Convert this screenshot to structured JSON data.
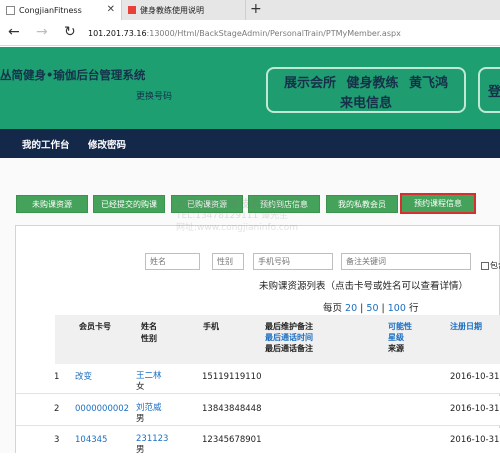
{
  "browser": {
    "active_tab_title": "CongjianFitness",
    "inactive_tab_title": "健身教练使用说明",
    "new_tab_glyph": "+",
    "close_glyph": "✕",
    "url_host": "101.201.73.16",
    "url_path": ":13000/Html/BackStageAdmin/PersonalTrain/PTMyMember.aspx"
  },
  "header": {
    "brand": "丛简健身•瑜伽后台管理系统",
    "change_number": "更换号码",
    "caller_box": {
      "show_store": "展示会所",
      "role": "健身教练",
      "person": "黄飞鸿",
      "caption": "来电信息"
    },
    "side_box_text": "登"
  },
  "nav": {
    "items": [
      "我的工作台",
      "修改密码"
    ]
  },
  "actions": {
    "buttons": [
      "未购课资源",
      "已经提交的购课",
      "已购课资源",
      "预约到店信息",
      "我的私教会员",
      "预约课程信息"
    ],
    "active_index": 5
  },
  "watermark": {
    "line1": "大连丛简创想技术有限公司",
    "line2": "TEL:13478129111 谭先生",
    "line3": "网址:www.congjianinfo.com"
  },
  "filters": {
    "name_placeholder": "姓名",
    "gender_placeholder": "性别",
    "phone_placeholder": "手机号码",
    "keyword_placeholder": "备注关键词",
    "checkbox_label": "包含"
  },
  "list": {
    "title": "未购课资源列表（点击卡号或姓名可以查看详情）",
    "page_size_label": "每页",
    "page_sizes": [
      "20",
      "50",
      "100"
    ],
    "page_size_unit": "行",
    "separator": "|"
  },
  "table": {
    "headers": {
      "card": "会员卡号",
      "name": "姓名",
      "gender": "性别",
      "phone": "手机",
      "last_maintain": "最后维护备注",
      "last_call_time": "最后通话时间",
      "last_call_note": "最后通话备注",
      "possibility": "可能性",
      "level": "星级",
      "source": "来源",
      "reg_date": "注册日期"
    },
    "rows": [
      {
        "index": "1",
        "card": "改变",
        "name": "王二林",
        "gender": "女",
        "phone": "15119119110",
        "date": "2016-10-31"
      },
      {
        "index": "2",
        "card": "0000000002",
        "name": "刘范威",
        "gender": "男",
        "phone": "13843848448",
        "date": "2016-10-31"
      },
      {
        "index": "3",
        "card": "104345",
        "name": "231123",
        "gender": "男",
        "phone": "12345678901",
        "date": "2016-10-31"
      }
    ]
  },
  "colors": {
    "header_green": "#1d9f72",
    "nav_navy": "#14294a",
    "button_green": "#44a25a",
    "active_border": "#d72e2e",
    "link_blue": "#1a6ec2"
  }
}
